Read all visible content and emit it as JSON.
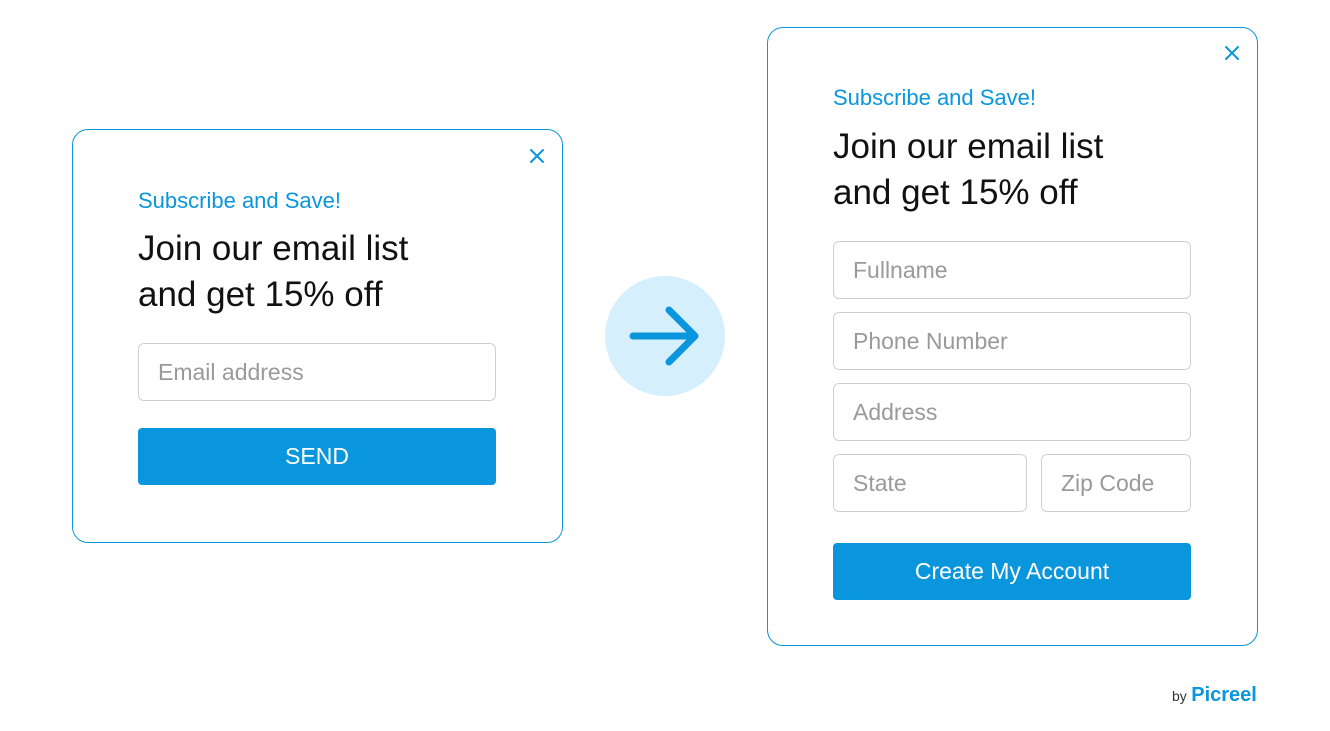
{
  "simple_popup": {
    "eyebrow": "Subscribe and Save!",
    "headline_line1": "Join our email list",
    "headline_line2": "and get 15% off",
    "email_placeholder": "Email address",
    "submit_label": "SEND"
  },
  "full_popup": {
    "eyebrow": "Subscribe and Save!",
    "headline_line1": "Join our email list",
    "headline_line2": "and get 15% off",
    "fields": {
      "fullname_placeholder": "Fullname",
      "phone_placeholder": "Phone Number",
      "address_placeholder": "Address",
      "state_placeholder": "State",
      "zip_placeholder": "Zip Code"
    },
    "submit_label": "Create My Account"
  },
  "transition": {
    "icon": "arrow-right-icon"
  },
  "branding": {
    "prefix": "by",
    "name": "Picreel"
  },
  "colors": {
    "accent": "#0a96dc",
    "circle_bg": "#d5effd",
    "field_border": "#cfcfcf",
    "placeholder": "#9a9a9a",
    "headline": "#111111"
  },
  "icons": {
    "close": "close-icon",
    "arrow": "arrow-right-icon"
  }
}
